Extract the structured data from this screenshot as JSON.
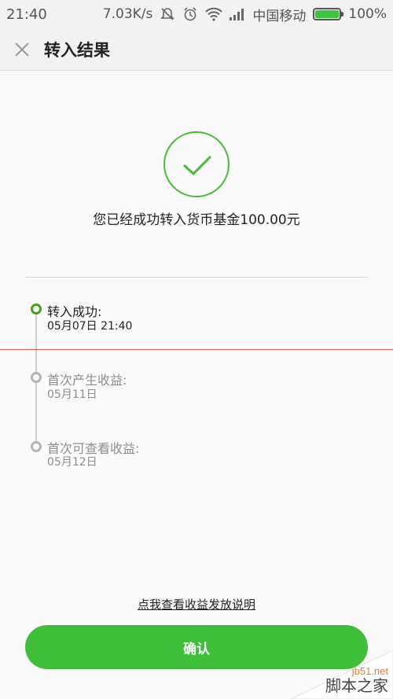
{
  "status_bar": {
    "time": "21:40",
    "speed": "7.03K/s",
    "carrier": "中国移动",
    "battery": "100%",
    "icons": [
      "mute-icon",
      "alarm-icon",
      "wifi-icon",
      "signal-icon",
      "battery-icon"
    ]
  },
  "header": {
    "close_icon": "close-icon",
    "title": "转入结果"
  },
  "result": {
    "icon": "check-icon",
    "message": "您已经成功转入货币基金100.00元"
  },
  "timeline": [
    {
      "label": "转入成功:",
      "date": "05月07日 21:40",
      "state": "active"
    },
    {
      "label": "首次产生收益:",
      "date": "05月11日",
      "state": "pending"
    },
    {
      "label": "首次可查看收益:",
      "date": "05月12日",
      "state": "pending"
    }
  ],
  "footer": {
    "explain_link": "点我查看收益发放说明",
    "confirm_label": "确认"
  },
  "watermark": {
    "site": "jb51.net",
    "name": "脚本之家"
  },
  "colors": {
    "accent_green": "#3fbe38",
    "timeline_active": "#4b9d1f",
    "timeline_pending": "#b5b5b5",
    "red_line": "#e5614f"
  }
}
